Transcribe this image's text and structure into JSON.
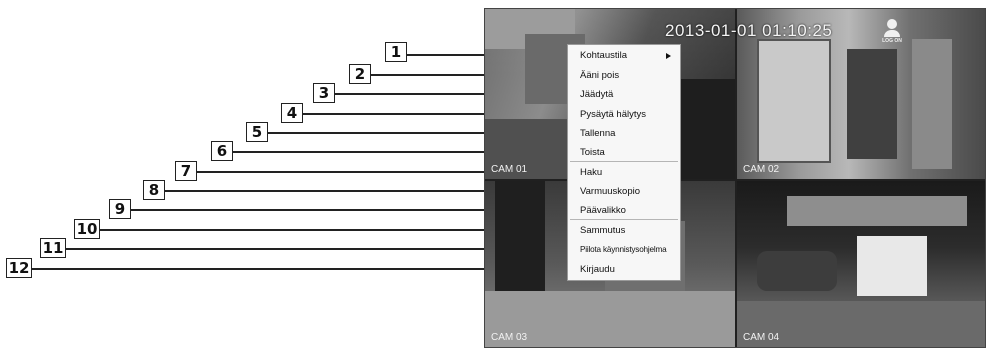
{
  "screen": {
    "timestamp": "2013-01-01 01:10:25",
    "logon_label": "LOG ON",
    "cameras": [
      "CAM 01",
      "CAM 02",
      "CAM 03",
      "CAM 04"
    ]
  },
  "menu": {
    "items": [
      {
        "number": "1",
        "label": "Kohtaustila",
        "has_submenu": true
      },
      {
        "number": "2",
        "label": "Ääni pois"
      },
      {
        "number": "3",
        "label": "Jäädytä"
      },
      {
        "number": "4",
        "label": "Pysäytä hälytys"
      },
      {
        "number": "5",
        "label": "Tallenna"
      },
      {
        "number": "6",
        "label": "Toista"
      },
      {
        "number": "7",
        "label": "Haku"
      },
      {
        "number": "8",
        "label": "Varmuuskopio"
      },
      {
        "number": "9",
        "label": "Päävalikko"
      },
      {
        "number": "10",
        "label": "Sammutus"
      },
      {
        "number": "11",
        "label": "Piilota käynnistysohjelma"
      },
      {
        "number": "12",
        "label": "Kirjaudu"
      }
    ]
  }
}
